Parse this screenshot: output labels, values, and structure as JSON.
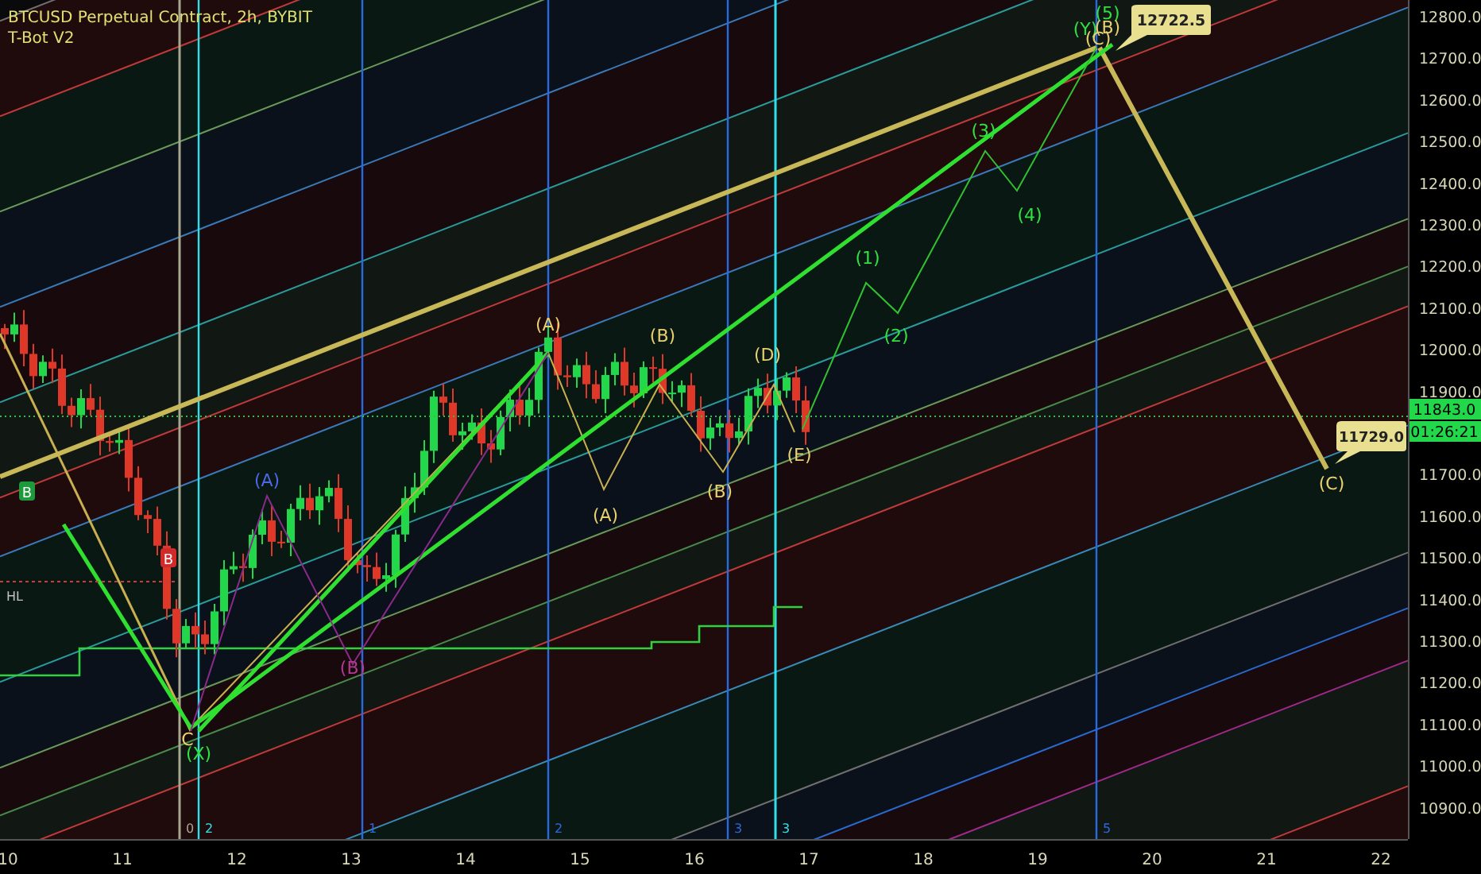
{
  "header": {
    "symbol": "BTCUSD Perpetual Contract, 2h, BYBIT",
    "indicator": "T-Bot V2"
  },
  "price_axis": {
    "labels": [
      "12800.0",
      "12700.0",
      "12600.0",
      "12500.0",
      "12400.0",
      "12300.0",
      "12200.0",
      "12100.0",
      "12000.0",
      "11900.0",
      "11700.0",
      "11600.0",
      "11500.0",
      "11400.0",
      "11300.0",
      "11200.0",
      "11100.0",
      "11000.0",
      "10900.0"
    ],
    "last_price": "11843.0",
    "countdown": "01:26:21"
  },
  "time_axis": {
    "labels": [
      "10",
      "11",
      "12",
      "13",
      "14",
      "15",
      "16",
      "17",
      "18",
      "19",
      "20",
      "21",
      "22"
    ]
  },
  "cycle_lines": [
    {
      "label": "0",
      "color": "#a8a890"
    },
    {
      "label": "2",
      "color": "#30e0e8"
    },
    {
      "label": "1",
      "color": "#2a6ae0"
    },
    {
      "label": "2",
      "color": "#2a6ae0"
    },
    {
      "label": "3",
      "color": "#2a6ae0"
    },
    {
      "label": "3",
      "color": "#30e0e8"
    },
    {
      "label": "5",
      "color": "#2a6ae0"
    }
  ],
  "wave_labels": [
    {
      "text": "C",
      "color": "#e8d070"
    },
    {
      "text": "(X)",
      "color": "#30e040"
    },
    {
      "text": "(A)",
      "color": "#4a6ae8"
    },
    {
      "text": "(B)",
      "color": "#b03a90"
    },
    {
      "text": "(A)",
      "color": "#e8d070"
    },
    {
      "text": "(A)",
      "color": "#e8d070"
    },
    {
      "text": "(B)",
      "color": "#e8d070"
    },
    {
      "text": "(B)",
      "color": "#e8d070"
    },
    {
      "text": "(D)",
      "color": "#e8d070"
    },
    {
      "text": "(E)",
      "color": "#e8d070"
    },
    {
      "text": "(1)",
      "color": "#30e040"
    },
    {
      "text": "(2)",
      "color": "#30e040"
    },
    {
      "text": "(3)",
      "color": "#30e040"
    },
    {
      "text": "(4)",
      "color": "#30e040"
    },
    {
      "text": "(Y)",
      "color": "#30e040"
    },
    {
      "text": "(C)",
      "color": "#e8d070"
    },
    {
      "text": "(5)",
      "color": "#30e040"
    },
    {
      "text": "(B)",
      "color": "#e8d070"
    },
    {
      "text": "(C)",
      "color": "#e8d070"
    }
  ],
  "price_callouts": [
    {
      "text": "12722.5"
    },
    {
      "text": "11729.0"
    }
  ],
  "signal_tags": [
    {
      "text": "B",
      "color": "#1e9a3a"
    },
    {
      "text": "B",
      "color": "#d02a2a"
    }
  ],
  "level_label": "HL"
}
